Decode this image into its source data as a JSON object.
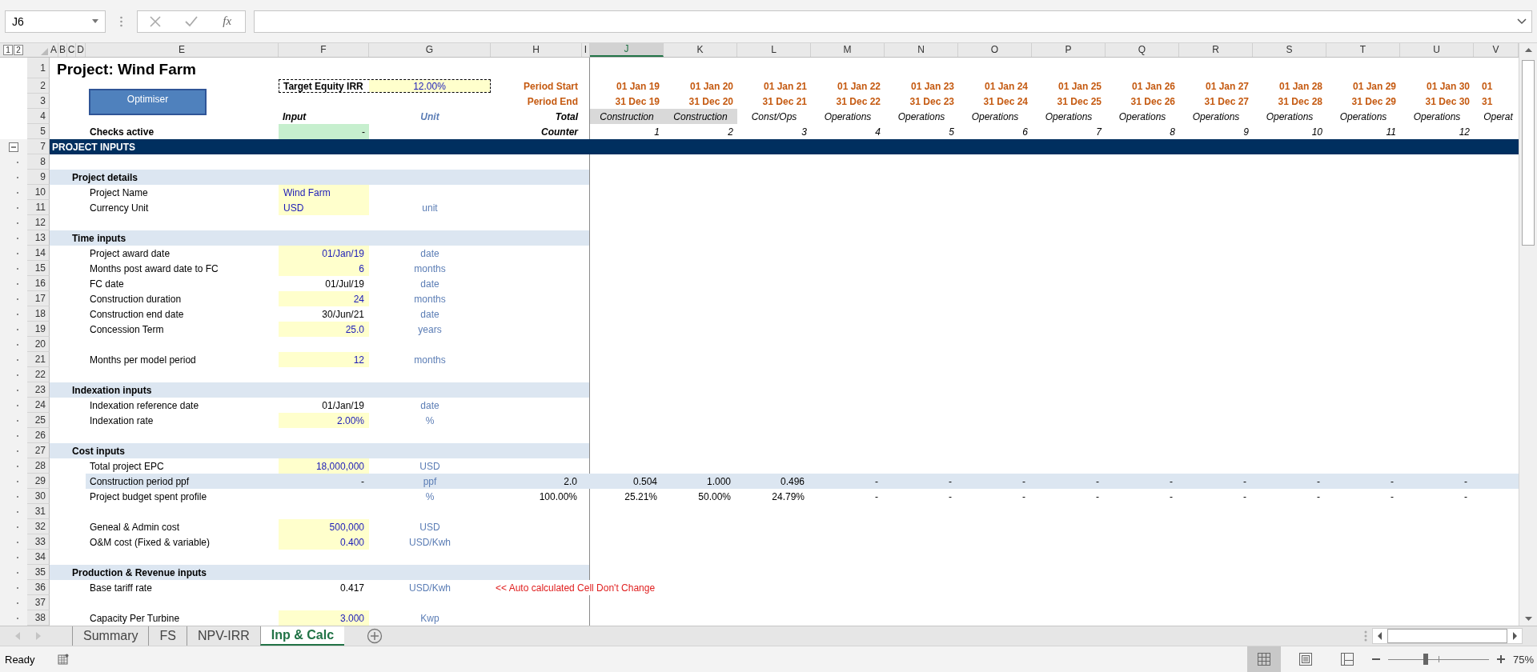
{
  "name_box": "J6",
  "formula_button": "fx",
  "outline_levels": [
    "1",
    "2"
  ],
  "columns": [
    {
      "label": "A",
      "selected": false
    },
    {
      "label": "B",
      "selected": false
    },
    {
      "label": "C",
      "selected": false
    },
    {
      "label": "D",
      "selected": false
    },
    {
      "label": "E",
      "selected": false
    },
    {
      "label": "F",
      "selected": false
    },
    {
      "label": "G",
      "selected": false
    },
    {
      "label": "H",
      "selected": false
    },
    {
      "label": "I",
      "selected": false
    },
    {
      "label": "J",
      "selected": true
    },
    {
      "label": "K",
      "selected": false
    },
    {
      "label": "L",
      "selected": false
    },
    {
      "label": "M",
      "selected": false
    },
    {
      "label": "N",
      "selected": false
    },
    {
      "label": "O",
      "selected": false
    },
    {
      "label": "P",
      "selected": false
    },
    {
      "label": "Q",
      "selected": false
    },
    {
      "label": "R",
      "selected": false
    },
    {
      "label": "S",
      "selected": false
    },
    {
      "label": "T",
      "selected": false
    },
    {
      "label": "U",
      "selected": false
    },
    {
      "label": "V",
      "selected": false
    }
  ],
  "header": {
    "row_numbers": [
      "1",
      "2",
      "3",
      "4",
      "5"
    ],
    "title": "Project: Wind Farm",
    "optimiser_button": "Optimiser",
    "target_irr_label": "Target Equity IRR",
    "target_irr_value": "12.00%",
    "period_start": "Period Start",
    "period_end": "Period End",
    "input": "Input",
    "unit": "Unit",
    "total": "Total",
    "checks_label": "Checks active",
    "checks_value": "-",
    "counter": "Counter"
  },
  "periods": [
    {
      "start": "01 Jan 19",
      "end": "31 Dec 19",
      "phase": "Construction",
      "shaded": true,
      "counter": "1"
    },
    {
      "start": "01 Jan 20",
      "end": "31 Dec 20",
      "phase": "Construction",
      "shaded": true,
      "counter": "2"
    },
    {
      "start": "01 Jan 21",
      "end": "31 Dec 21",
      "phase": "Const/Ops",
      "shaded": false,
      "counter": "3"
    },
    {
      "start": "01 Jan 22",
      "end": "31 Dec 22",
      "phase": "Operations",
      "shaded": false,
      "counter": "4"
    },
    {
      "start": "01 Jan 23",
      "end": "31 Dec 23",
      "phase": "Operations",
      "shaded": false,
      "counter": "5"
    },
    {
      "start": "01 Jan 24",
      "end": "31 Dec 24",
      "phase": "Operations",
      "shaded": false,
      "counter": "6"
    },
    {
      "start": "01 Jan 25",
      "end": "31 Dec 25",
      "phase": "Operations",
      "shaded": false,
      "counter": "7"
    },
    {
      "start": "01 Jan 26",
      "end": "31 Dec 26",
      "phase": "Operations",
      "shaded": false,
      "counter": "8"
    },
    {
      "start": "01 Jan 27",
      "end": "31 Dec 27",
      "phase": "Operations",
      "shaded": false,
      "counter": "9"
    },
    {
      "start": "01 Jan 28",
      "end": "31 Dec 28",
      "phase": "Operations",
      "shaded": false,
      "counter": "10"
    },
    {
      "start": "01 Jan 29",
      "end": "31 Dec 29",
      "phase": "Operations",
      "shaded": false,
      "counter": "11"
    },
    {
      "start": "01 Jan 30",
      "end": "31 Dec 30",
      "phase": "Operations",
      "shaded": false,
      "counter": "12"
    },
    {
      "start": "01",
      "end": "31",
      "phase": "Operat",
      "shaded": false
    }
  ],
  "rows": [
    {
      "number": "7",
      "kind": "banner",
      "label": "PROJECT INPUTS",
      "expanded": true
    },
    {
      "number": "8",
      "kind": "blank"
    },
    {
      "number": "9",
      "kind": "section",
      "label": "Project details"
    },
    {
      "number": "10",
      "kind": "item",
      "label": "Project Name",
      "input": "Wind Farm",
      "input_highlighted": true,
      "numeric": false,
      "banded": false
    },
    {
      "number": "11",
      "kind": "item",
      "label": "Currency Unit",
      "input": "USD",
      "input_highlighted": true,
      "numeric": false,
      "unit": "unit",
      "banded": false
    },
    {
      "number": "12",
      "kind": "blank"
    },
    {
      "number": "13",
      "kind": "section",
      "label": "Time inputs"
    },
    {
      "number": "14",
      "kind": "item",
      "label": "Project award date",
      "input": "01/Jan/19",
      "input_highlighted": true,
      "numeric": true,
      "unit": "date",
      "banded": false
    },
    {
      "number": "15",
      "kind": "item",
      "label": "Months post award date to FC",
      "input": "6",
      "input_highlighted": true,
      "numeric": true,
      "unit": "months",
      "banded": false
    },
    {
      "number": "16",
      "kind": "item",
      "label": "FC date",
      "input": "01/Jul/19",
      "input_highlighted": false,
      "numeric": true,
      "unit": "date",
      "banded": false
    },
    {
      "number": "17",
      "kind": "item",
      "label": "Construction duration",
      "input": "24",
      "input_highlighted": true,
      "numeric": true,
      "unit": "months",
      "banded": false
    },
    {
      "number": "18",
      "kind": "item",
      "label": "Construction end date",
      "input": "30/Jun/21",
      "input_highlighted": false,
      "numeric": true,
      "unit": "date",
      "banded": false
    },
    {
      "number": "19",
      "kind": "item",
      "label": "Concession Term",
      "input": "25.0",
      "input_highlighted": true,
      "numeric": true,
      "unit": "years",
      "banded": false
    },
    {
      "number": "20",
      "kind": "blank"
    },
    {
      "number": "21",
      "kind": "item",
      "label": "Months per model period",
      "input": "12",
      "input_highlighted": true,
      "numeric": true,
      "unit": "months",
      "banded": false
    },
    {
      "number": "22",
      "kind": "blank"
    },
    {
      "number": "23",
      "kind": "section",
      "label": "Indexation inputs"
    },
    {
      "number": "24",
      "kind": "item",
      "label": "Indexation reference date",
      "input": "01/Jan/19",
      "input_highlighted": false,
      "numeric": true,
      "unit": "date",
      "banded": false
    },
    {
      "number": "25",
      "kind": "item",
      "label": "Indexation rate",
      "input": "2.00%",
      "input_highlighted": true,
      "numeric": true,
      "unit": "%",
      "banded": false
    },
    {
      "number": "26",
      "kind": "blank"
    },
    {
      "number": "27",
      "kind": "section",
      "label": "Cost inputs"
    },
    {
      "number": "28",
      "kind": "item",
      "label": "Total project EPC",
      "input": "18,000,000",
      "input_highlighted": true,
      "numeric": true,
      "unit": "USD",
      "banded": false
    },
    {
      "number": "29",
      "kind": "item",
      "label": "Construction period ppf",
      "input": "-",
      "input_highlighted": false,
      "numeric": true,
      "unit": "ppf",
      "total": "2.0",
      "banded": true,
      "periods": [
        "0.504",
        "1.000",
        "0.496",
        "-",
        "-",
        "-",
        "-",
        "-",
        "-",
        "-",
        "-",
        "-"
      ]
    },
    {
      "number": "30",
      "kind": "item",
      "label": "Project budget spent profile",
      "unit": "%",
      "total": "100.00%",
      "banded": false,
      "periods": [
        "25.21%",
        "50.00%",
        "24.79%",
        "-",
        "-",
        "-",
        "-",
        "-",
        "-",
        "-",
        "-",
        "-"
      ]
    },
    {
      "number": "31",
      "kind": "blank"
    },
    {
      "number": "32",
      "kind": "item",
      "label": "Geneal & Admin cost",
      "input": "500,000",
      "input_highlighted": true,
      "numeric": true,
      "unit": "USD",
      "banded": false
    },
    {
      "number": "33",
      "kind": "item",
      "label": "O&M cost (Fixed & variable)",
      "input": "0.400",
      "input_highlighted": true,
      "numeric": true,
      "unit": "USD/Kwh",
      "banded": false
    },
    {
      "number": "34",
      "kind": "blank"
    },
    {
      "number": "35",
      "kind": "section",
      "label": "Production & Revenue inputs"
    },
    {
      "number": "36",
      "kind": "item",
      "label": "Base tariff rate",
      "input": "0.417",
      "input_highlighted": false,
      "numeric": true,
      "unit": "USD/Kwh",
      "note": "<< Auto calculated Cell Don't Change",
      "banded": false
    },
    {
      "number": "37",
      "kind": "blank"
    },
    {
      "number": "38",
      "kind": "item",
      "label": "Capacity Per Turbine",
      "input": "3.000",
      "input_highlighted": true,
      "numeric": true,
      "unit": "Kwp",
      "banded": false
    }
  ],
  "sheet_tabs": [
    {
      "label": "Summary",
      "selected": false
    },
    {
      "label": "FS",
      "selected": false
    },
    {
      "label": "NPV-IRR",
      "selected": false
    },
    {
      "label": "Inp & Calc",
      "selected": true
    }
  ],
  "status": "Ready",
  "views": [
    {
      "kind": "normal",
      "selected": true
    },
    {
      "kind": "page-layout",
      "selected": false
    },
    {
      "kind": "page-break",
      "selected": false
    }
  ],
  "zoom": {
    "level": 0.37,
    "reading": "75%"
  }
}
